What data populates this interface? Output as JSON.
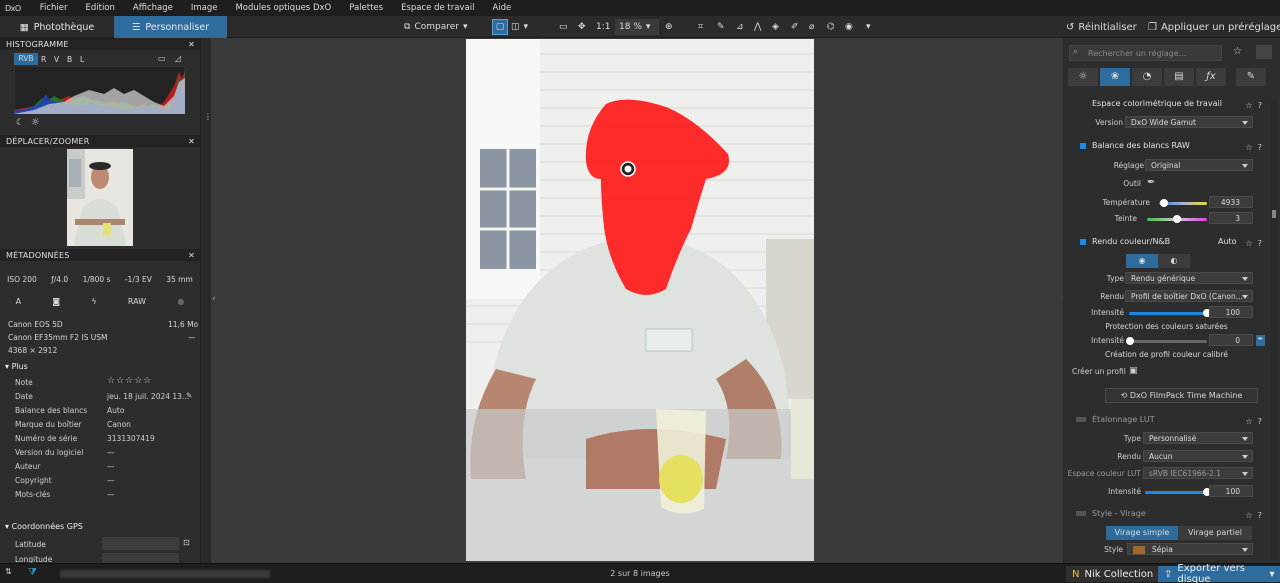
{
  "app": {
    "logo": "DxO"
  },
  "menu": [
    "Fichier",
    "Edition",
    "Affichage",
    "Image",
    "Modules optiques DxO",
    "Palettes",
    "Espace de travail",
    "Aide"
  ],
  "tabs": {
    "library": "Photothèque",
    "customize": "Personnaliser"
  },
  "toolbar": {
    "compare": "Comparer",
    "ratio": "1:1",
    "zoom": "18 %",
    "reset": "Réinitialiser",
    "apply_preset": "Appliquer un préréglage"
  },
  "left": {
    "histogram": {
      "title": "HISTOGRAMME",
      "channels": [
        "RVB",
        "R",
        "V",
        "B",
        "L"
      ]
    },
    "navigator": {
      "title": "DÉPLACER/ZOOMER"
    },
    "metadata": {
      "title": "MÉTADONNÉES",
      "exif": [
        "ISO 200",
        "ƒ/4.0",
        "1/800 s",
        "-1/3 EV",
        "35 mm"
      ],
      "modes": [
        "A",
        "",
        "",
        "RAW",
        ""
      ],
      "camera": "Canon EOS 5D",
      "size": "11,6 Mo",
      "lens": "Canon EF35mm F2 IS USM",
      "lens_extra": "—",
      "dimensions": "4368 × 2912",
      "more_title": "Plus",
      "rows": [
        {
          "k": "Note",
          "v": "☆☆☆☆☆"
        },
        {
          "k": "Date",
          "v": "jeu. 18 juil. 2024 13..."
        },
        {
          "k": "Balance des blancs",
          "v": "Auto"
        },
        {
          "k": "Marque du boîtier",
          "v": "Canon"
        },
        {
          "k": "Numéro de série",
          "v": "3131307419"
        },
        {
          "k": "Version du logiciel",
          "v": "—"
        },
        {
          "k": "Auteur",
          "v": "—"
        },
        {
          "k": "Copyright",
          "v": "—"
        },
        {
          "k": "Mots-clés",
          "v": "—"
        }
      ],
      "gps_title": "Coordonnées GPS",
      "gps": {
        "lat": "Latitude",
        "lon": "Longitude"
      }
    }
  },
  "right": {
    "search_placeholder": "Rechercher un réglage...",
    "color_space": {
      "title": "Espace colorimétrique de travail",
      "version_label": "Version",
      "version": "DxO Wide Gamut"
    },
    "wb": {
      "title": "Balance des blancs RAW",
      "setting_label": "Réglage",
      "setting": "Original",
      "tool_label": "Outil",
      "temp_label": "Température",
      "temp": "4933",
      "tint_label": "Teinte",
      "tint": "3"
    },
    "render": {
      "title": "Rendu couleur/N&B",
      "mode": "Auto",
      "type_label": "Type",
      "type": "Rendu générique",
      "render_label": "Rendu",
      "render": "Profil de boîtier DxO (Canon...",
      "intensity_label": "Intensité",
      "intensity": "100",
      "protect_title": "Protection des couleurs saturées",
      "protect_label": "Intensité",
      "protect": "0",
      "profile_title": "Création de profil couleur calibré",
      "create_label": "Créer un profil",
      "filmpack": "DxO FilmPack Time Machine"
    },
    "lut": {
      "title": "Étalonnage LUT",
      "type_label": "Type",
      "type": "Personnalisé",
      "render_label": "Rendu",
      "render": "Aucun",
      "space_label": "Espace couleur LUT",
      "space": "sRVB IEC61966-2.1",
      "intensity_label": "Intensité",
      "intensity": "100"
    },
    "toning": {
      "title": "Style - Virage",
      "simple": "Virage simple",
      "partial": "Virage partiel",
      "style_label": "Style",
      "style": "Sépia"
    }
  },
  "bottom": {
    "count": "2 sur 8 images",
    "nik": "Nik Collection",
    "export": "Exporter vers disque"
  },
  "colors": {
    "accent": "#2f6c9e",
    "mask": "#ff1a1a"
  }
}
